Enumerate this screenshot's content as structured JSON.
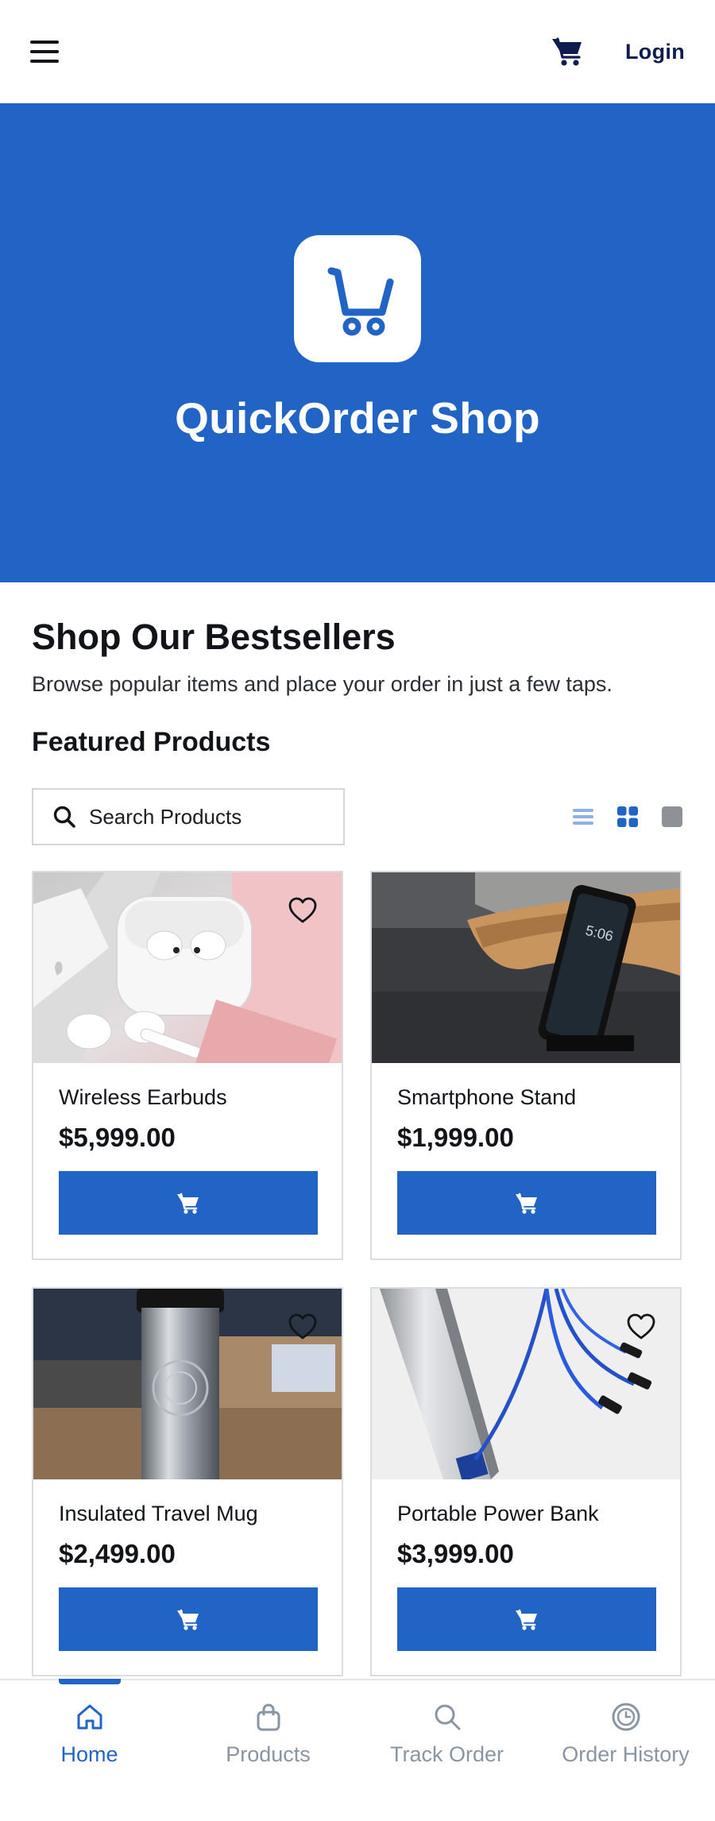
{
  "header": {
    "menu_icon": "hamburger-menu-icon",
    "cart_icon": "shopping-cart-icon",
    "login_label": "Login"
  },
  "hero": {
    "logo_icon": "shopping-cart-icon",
    "title": "QuickOrder Shop",
    "background": "#2264c6"
  },
  "main": {
    "title": "Shop Our Bestsellers",
    "subtitle": "Browse popular items and place your order in just a few taps.",
    "featured_heading": "Featured Products",
    "search": {
      "placeholder": "Search Products",
      "value": "",
      "icon": "search-icon"
    },
    "view_modes": [
      {
        "icon": "list-view-icon"
      },
      {
        "icon": "grid-view-icon"
      },
      {
        "icon": "large-view-icon"
      }
    ],
    "products": [
      {
        "name": "Wireless Earbuds",
        "price": "$5,999.00",
        "favorite_icon": "heart-outline-icon",
        "add_icon": "cart-icon"
      },
      {
        "name": "Smartphone Stand",
        "price": "$1,999.00",
        "favorite_icon": "heart-outline-icon",
        "add_icon": "cart-icon"
      },
      {
        "name": "Insulated Travel Mug",
        "price": "$2,499.00",
        "favorite_icon": "heart-outline-icon",
        "add_icon": "cart-icon"
      },
      {
        "name": "Portable Power Bank",
        "price": "$3,999.00",
        "favorite_icon": "heart-outline-icon",
        "add_icon": "cart-icon"
      }
    ]
  },
  "bottom_nav": {
    "items": [
      {
        "label": "Home",
        "icon": "home-icon",
        "active": true
      },
      {
        "label": "Products",
        "icon": "shopping-bag-icon",
        "active": false
      },
      {
        "label": "Track Order",
        "icon": "search-icon",
        "active": false
      },
      {
        "label": "Order History",
        "icon": "clock-icon",
        "active": false
      }
    ]
  },
  "colors": {
    "primary": "#2264c6",
    "nav_inactive": "#8a95a3",
    "header_text": "#0e1c4f"
  }
}
